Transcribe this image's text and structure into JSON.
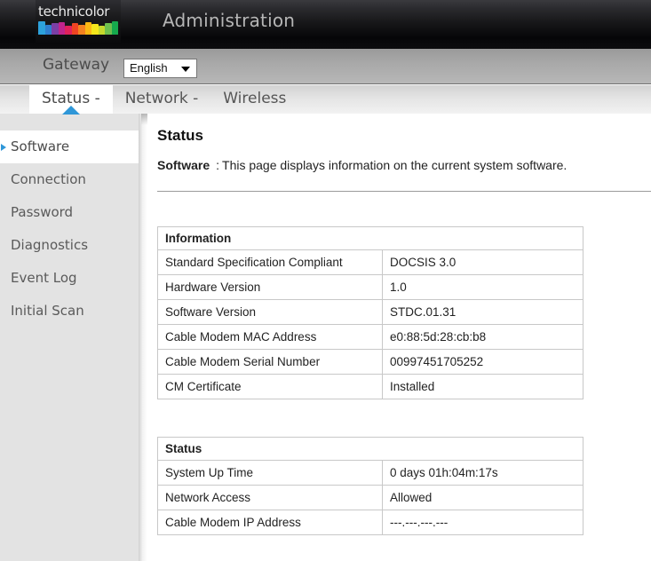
{
  "header": {
    "logo_text": "technicolor",
    "logo_icon": "technicolor-rainbow-logo",
    "title": "Administration"
  },
  "gateway_bar": {
    "label": "Gateway",
    "language": {
      "selected": "English",
      "options": [
        "English"
      ],
      "caret_icon": "chevron-down-icon"
    }
  },
  "tabs": [
    {
      "label": "Status -",
      "active": true
    },
    {
      "label": "Network -",
      "active": false
    },
    {
      "label": "Wireless",
      "active": false
    }
  ],
  "sidebar": {
    "items": [
      {
        "label": "Software",
        "active": true,
        "marker_icon": "triangle-right-icon"
      },
      {
        "label": "Connection",
        "active": false
      },
      {
        "label": "Password",
        "active": false
      },
      {
        "label": "Diagnostics",
        "active": false
      },
      {
        "label": "Event Log",
        "active": false
      },
      {
        "label": "Initial Scan",
        "active": false
      }
    ]
  },
  "main": {
    "page_title": "Status",
    "subtitle_label": "Software",
    "subtitle_separator": ":",
    "subtitle_text": "This page displays information on the current system software.",
    "tables": [
      {
        "header": "Information",
        "rows": [
          {
            "name": "Standard Specification Compliant",
            "value": "DOCSIS 3.0"
          },
          {
            "name": "Hardware Version",
            "value": "1.0"
          },
          {
            "name": "Software Version",
            "value": "STDC.01.31"
          },
          {
            "name": "Cable Modem MAC Address",
            "value": "e0:88:5d:28:cb:b8"
          },
          {
            "name": "Cable Modem Serial Number",
            "value": "00997451705252"
          },
          {
            "name": "CM Certificate",
            "value": "Installed"
          }
        ]
      },
      {
        "header": "Status",
        "rows": [
          {
            "name": "System Up Time",
            "value": "0 days 01h:04m:17s"
          },
          {
            "name": "Network Access",
            "value": "Allowed"
          },
          {
            "name": "Cable Modem IP Address",
            "value": "---.---.---.---"
          }
        ]
      }
    ]
  },
  "colors": {
    "accent_blue": "#2f97d8",
    "header_dark": "#0c0c0e",
    "gateway_gray": "#a8a8a8",
    "sidebar_gray": "#e3e3e3",
    "table_border": "#c8c8c8"
  }
}
